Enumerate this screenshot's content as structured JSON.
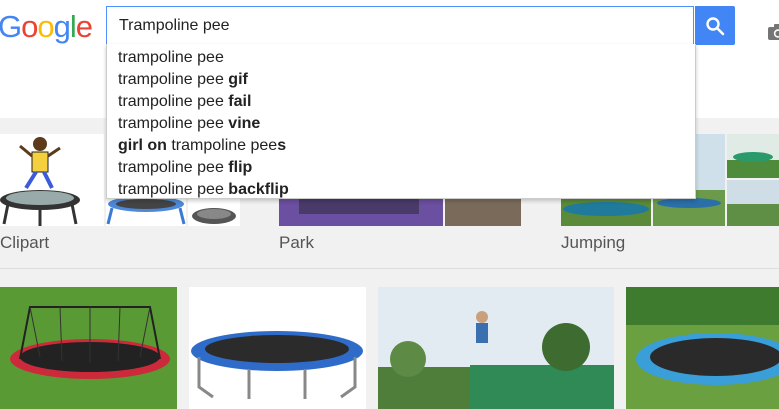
{
  "header": {
    "logo_letters": [
      {
        "ch": "G",
        "color": "#4285f4"
      },
      {
        "ch": "o",
        "color": "#ea4335"
      },
      {
        "ch": "o",
        "color": "#fbbc05"
      },
      {
        "ch": "g",
        "color": "#4285f4"
      },
      {
        "ch": "l",
        "color": "#34a853"
      },
      {
        "ch": "e",
        "color": "#ea4335"
      }
    ],
    "search_value": "Trampoline pee",
    "camera_icon": "camera-icon",
    "search_icon": "magnifier-icon",
    "accent": "#4285f4"
  },
  "suggestions": [
    {
      "prefix": "trampoline pee",
      "bold": "",
      "suffix": ""
    },
    {
      "prefix": "trampoline pee ",
      "bold": "gif",
      "suffix": ""
    },
    {
      "prefix": "trampoline pee ",
      "bold": "fail",
      "suffix": ""
    },
    {
      "prefix": "trampoline pee ",
      "bold": "vine",
      "suffix": ""
    },
    {
      "prefix": "",
      "bold": "girl on",
      "suffix": " trampoline pee",
      "bold2": "s"
    },
    {
      "prefix": "trampoline pee ",
      "bold": "flip",
      "suffix": ""
    },
    {
      "prefix": "trampoline pee ",
      "bold": "backflip",
      "suffix": ""
    }
  ],
  "categories": [
    {
      "label": "Clipart"
    },
    {
      "label": "Park"
    },
    {
      "label": "Jumping"
    }
  ]
}
